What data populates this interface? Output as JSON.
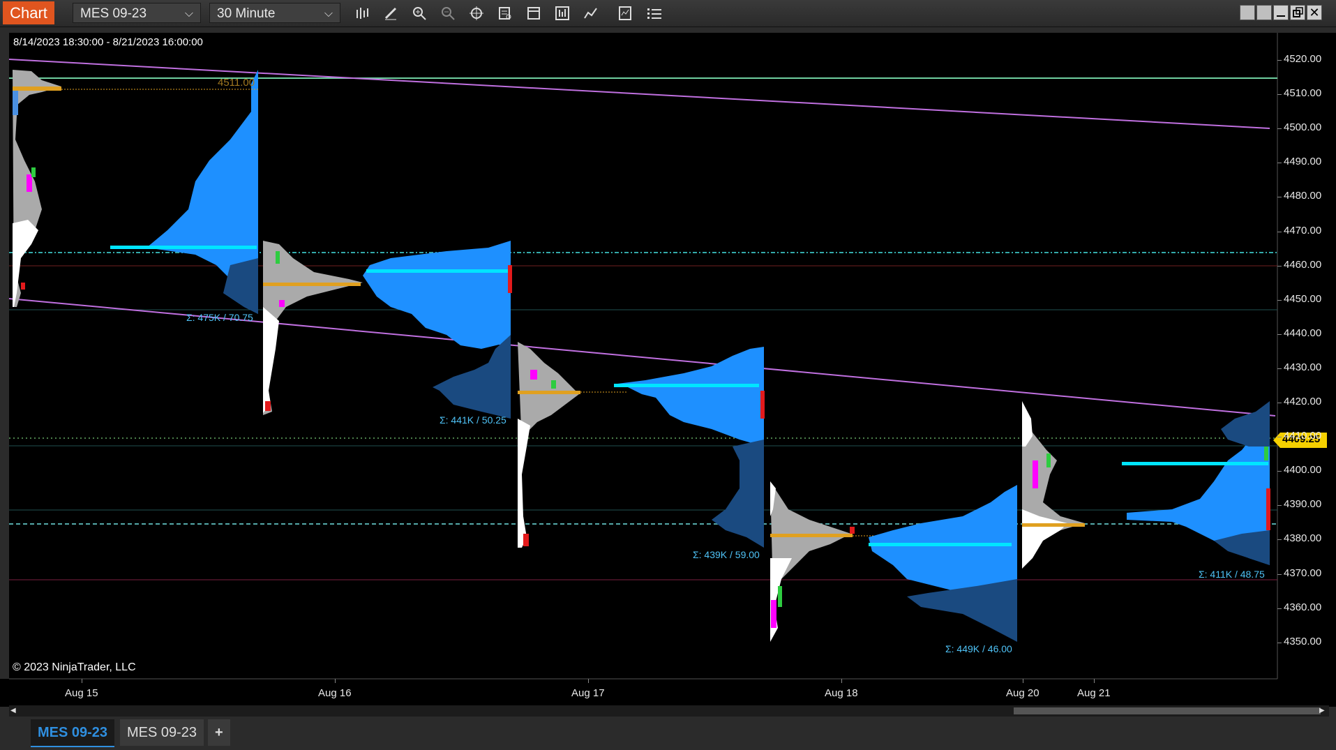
{
  "toolbar": {
    "chart_label": "Chart",
    "instrument": "MES 09-23",
    "interval": "30 Minute",
    "tools": [
      "bar-type-icon",
      "draw-pencil-icon",
      "zoom-in-icon",
      "zoom-out-icon",
      "crosshair-icon",
      "data-box-icon",
      "properties-icon",
      "strategies-icon",
      "indicators-icon",
      "templates-icon",
      "list-icon"
    ]
  },
  "chart": {
    "date_range": "8/14/2023 18:30:00 - 8/21/2023 16:00:00",
    "copyright": "© 2023 NinjaTrader, LLC",
    "current_price": "4409.25",
    "price_labels": [
      "4520.00",
      "4510.00",
      "4500.00",
      "4490.00",
      "4480.00",
      "4470.00",
      "4460.00",
      "4450.00",
      "4440.00",
      "4430.00",
      "4420.00",
      "4410.00",
      "4400.00",
      "4390.00",
      "4380.00",
      "4370.00",
      "4360.00",
      "4350.00"
    ],
    "date_labels": [
      "Aug 15",
      "Aug 16",
      "Aug 17",
      "Aug 18",
      "Aug 20",
      "Aug 21"
    ],
    "poc_label": "4511.00",
    "profile_stats": [
      "Σ: 475K / 70.75",
      "Σ: 441K / 50.25",
      "Σ: 439K / 59.00",
      "Σ: 449K / 46.00",
      "Σ: 411K / 48.75"
    ]
  },
  "tabs": {
    "tab1": "MES 09-23",
    "tab2": "MES 09-23",
    "add": "+"
  },
  "colors": {
    "accent": "#e0551f",
    "profile_blue": "#1e90ff",
    "profile_dark": "#1a4a80",
    "poc_cyan": "#00e5ff",
    "poc_orange": "#e0a020",
    "trendline": "#c070e0",
    "price_marker": "#f5d000"
  }
}
